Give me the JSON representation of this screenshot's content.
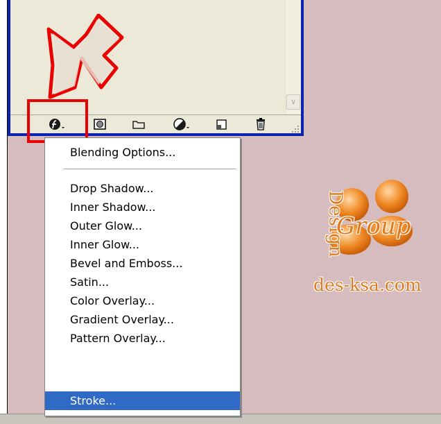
{
  "colors": {
    "background": "#d6bcbe",
    "panel": "#ece9d8",
    "frame_blue": "#0a24b0",
    "highlight_red": "#ea0000",
    "menu_selection": "#316ac5",
    "watermark_orange": "#e07a1a"
  },
  "toolbar": {
    "icons": [
      "layer-style-fx-icon",
      "layer-mask-icon",
      "new-group-folder-icon",
      "adjustment-layer-icon",
      "new-layer-icon",
      "trash-icon"
    ]
  },
  "menu": {
    "items": [
      "Blending Options...",
      "Drop Shadow...",
      "Inner Shadow...",
      "Outer Glow...",
      "Inner Glow...",
      "Bevel and Emboss...",
      "Satin...",
      "Color Overlay...",
      "Gradient Overlay...",
      "Pattern Overlay...",
      "Stroke..."
    ],
    "selected": "Stroke..."
  },
  "watermark": {
    "word1": "Design",
    "word2": "Group",
    "site": "des-ksa.com"
  }
}
